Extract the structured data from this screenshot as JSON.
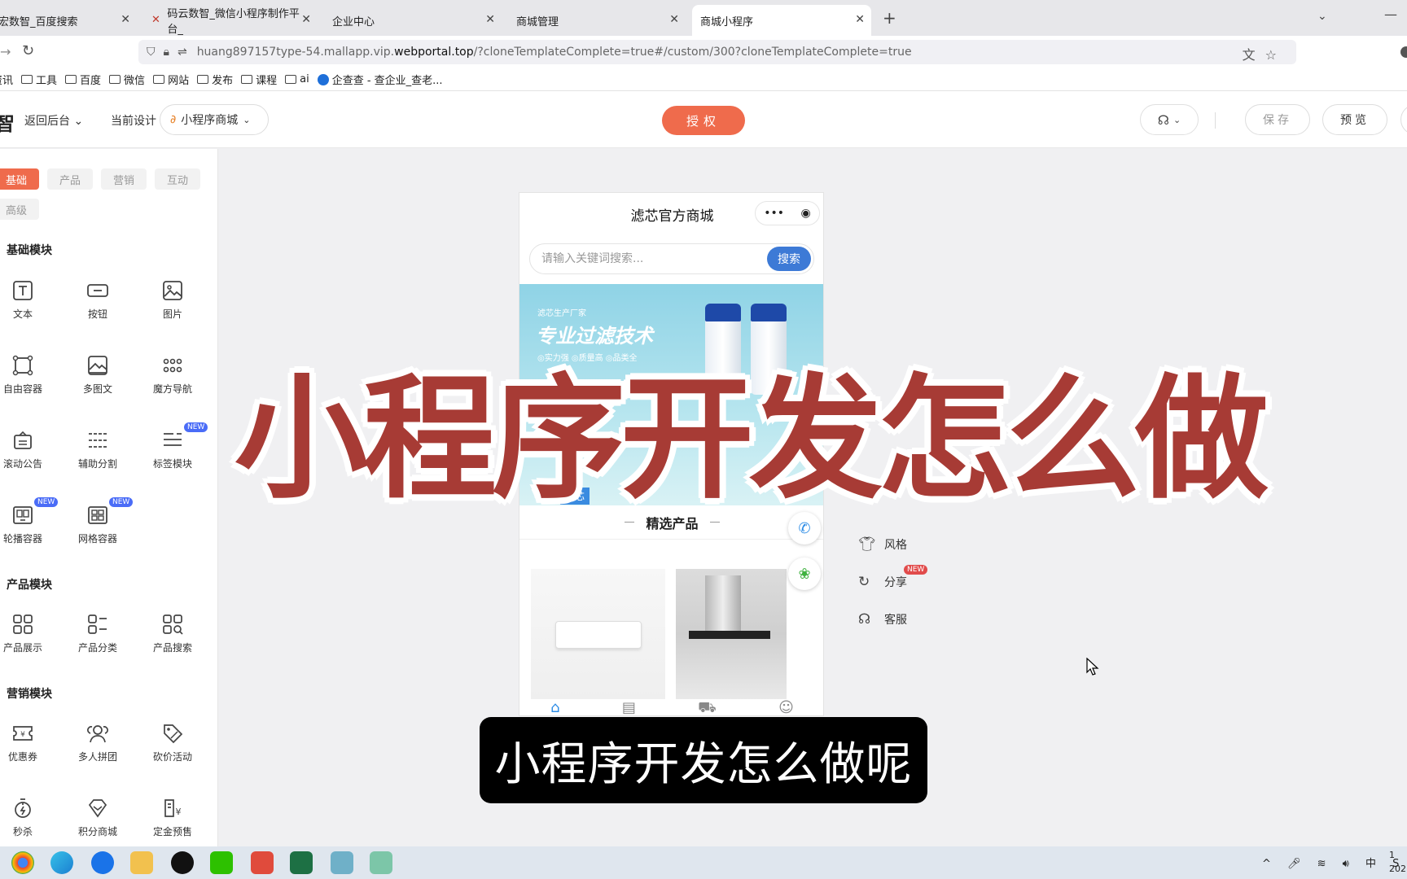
{
  "browser": {
    "tabs": [
      {
        "label": "宏数智_百度搜索"
      },
      {
        "label": "码云数智_微信小程序制作平台_"
      },
      {
        "label": "企业中心"
      },
      {
        "label": "商城管理"
      },
      {
        "label": "商城小程序"
      }
    ],
    "url_prefix": "huang897157type-54.mallapp.vip.",
    "url_domain": "webportal.top",
    "url_suffix": "/?cloneTemplateComplete=true#/custom/300?cloneTemplateComplete=true",
    "bookmarks": [
      "资讯",
      "工具",
      "百度",
      "微信",
      "网站",
      "发布",
      "课程",
      "ai",
      "企查查 - 查企业_查老..."
    ]
  },
  "header": {
    "logo_char": "智",
    "back_label": "返回后台",
    "current_design_label": "当前设计",
    "app_select_value": "小程序商城",
    "auth_label": "授权",
    "save_label": "保存",
    "preview_label": "预览"
  },
  "left_panel": {
    "tabs": [
      "基础",
      "产品",
      "营销",
      "互动",
      "高级"
    ],
    "sections": {
      "basic_title": "基础模块",
      "product_title": "产品模块",
      "marketing_title": "营销模块"
    },
    "basic_items": [
      "文本",
      "按钮",
      "图片",
      "自由容器",
      "多图文",
      "魔方导航",
      "滚动公告",
      "辅助分割",
      "标签模块",
      "轮播容器",
      "网格容器"
    ],
    "product_items": [
      "产品展示",
      "产品分类",
      "产品搜索"
    ],
    "marketing_items": [
      "优惠券",
      "多人拼团",
      "砍价活动",
      "秒杀",
      "积分商城",
      "定金预售"
    ],
    "new_badge": "NEW"
  },
  "phone": {
    "title": "滤芯官方商城",
    "search_placeholder": "请输入关键词搜索...",
    "search_button": "搜索",
    "banner_tag": "滤芯生产厂家",
    "banner_headline": "专业过滤技术",
    "banner_features": "◎实力强  ◎质量高  ◎品类全",
    "banner_brand": "滤芯",
    "section_title": "精选产品"
  },
  "settings_menu": [
    {
      "label": "风格",
      "icon": "shirt-icon"
    },
    {
      "label": "分享",
      "icon": "share-icon",
      "badge": "NEW"
    },
    {
      "label": "客服",
      "icon": "headset-icon"
    }
  ],
  "overlay": {
    "headline": "小程序开发怎么做",
    "subtitle": "小程序开发怎么做呢"
  },
  "taskbar": {
    "tray_text": "中",
    "clock_line1": "1",
    "clock_line2": "202"
  },
  "colors": {
    "accent": "#ef6b4c",
    "search_blue": "#3d7ad6",
    "overlay_red": "#a73b35"
  }
}
